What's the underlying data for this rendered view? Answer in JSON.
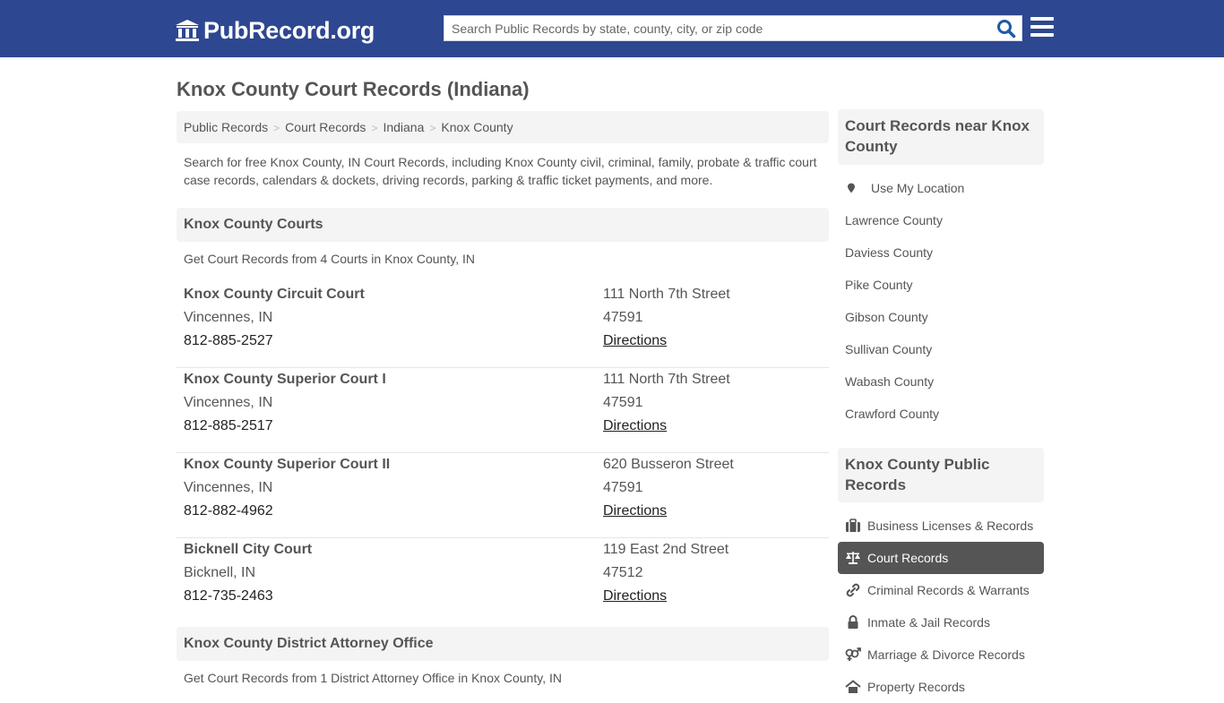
{
  "header": {
    "brand": "PubRecord.org",
    "search_placeholder": "Search Public Records by state, county, city, or zip code",
    "brand_color": "#2e4791"
  },
  "page_title": "Knox County Court Records (Indiana)",
  "breadcrumb": [
    "Public Records",
    "Court Records",
    "Indiana",
    "Knox County"
  ],
  "intro": "Search for free Knox County, IN Court Records, including Knox County civil, criminal, family, probate & traffic court case records, calendars & dockets, driving records, parking & traffic ticket payments, and more.",
  "courts_section": {
    "title": "Knox County Courts",
    "subtitle": "Get Court Records from 4 Courts in Knox County, IN",
    "courts": [
      {
        "name": "Knox County Circuit Court",
        "city": "Vincennes, IN",
        "phone": "812-885-2527",
        "address": "111 North 7th Street",
        "zip": "47591",
        "directions": "Directions"
      },
      {
        "name": "Knox County Superior Court I",
        "city": "Vincennes, IN",
        "phone": "812-885-2517",
        "address": "111 North 7th Street",
        "zip": "47591",
        "directions": "Directions"
      },
      {
        "name": "Knox County Superior Court II",
        "city": "Vincennes, IN",
        "phone": "812-882-4962",
        "address": "620 Busseron Street",
        "zip": "47591",
        "directions": "Directions"
      },
      {
        "name": "Bicknell City Court",
        "city": "Bicknell, IN",
        "phone": "812-735-2463",
        "address": "119 East 2nd Street",
        "zip": "47512",
        "directions": "Directions"
      }
    ]
  },
  "da_section": {
    "title": "Knox County District Attorney Office",
    "subtitle": "Get Court Records from 1 District Attorney Office in Knox County, IN"
  },
  "sidebar": {
    "nearby": {
      "title": "Court Records near Knox County",
      "use_location": "Use My Location",
      "counties": [
        "Lawrence County",
        "Daviess County",
        "Pike County",
        "Gibson County",
        "Sullivan County",
        "Wabash County",
        "Crawford County"
      ]
    },
    "public_records": {
      "title": "Knox County Public Records",
      "items": [
        {
          "label": "Business Licenses & Records",
          "icon": "briefcase-icon",
          "active": false
        },
        {
          "label": "Court Records",
          "icon": "scales-icon",
          "active": true
        },
        {
          "label": "Criminal Records & Warrants",
          "icon": "link-icon",
          "active": false
        },
        {
          "label": "Inmate & Jail Records",
          "icon": "lock-icon",
          "active": false
        },
        {
          "label": "Marriage & Divorce Records",
          "icon": "gender-icon",
          "active": false
        },
        {
          "label": "Property Records",
          "icon": "home-icon",
          "active": false
        }
      ]
    }
  }
}
